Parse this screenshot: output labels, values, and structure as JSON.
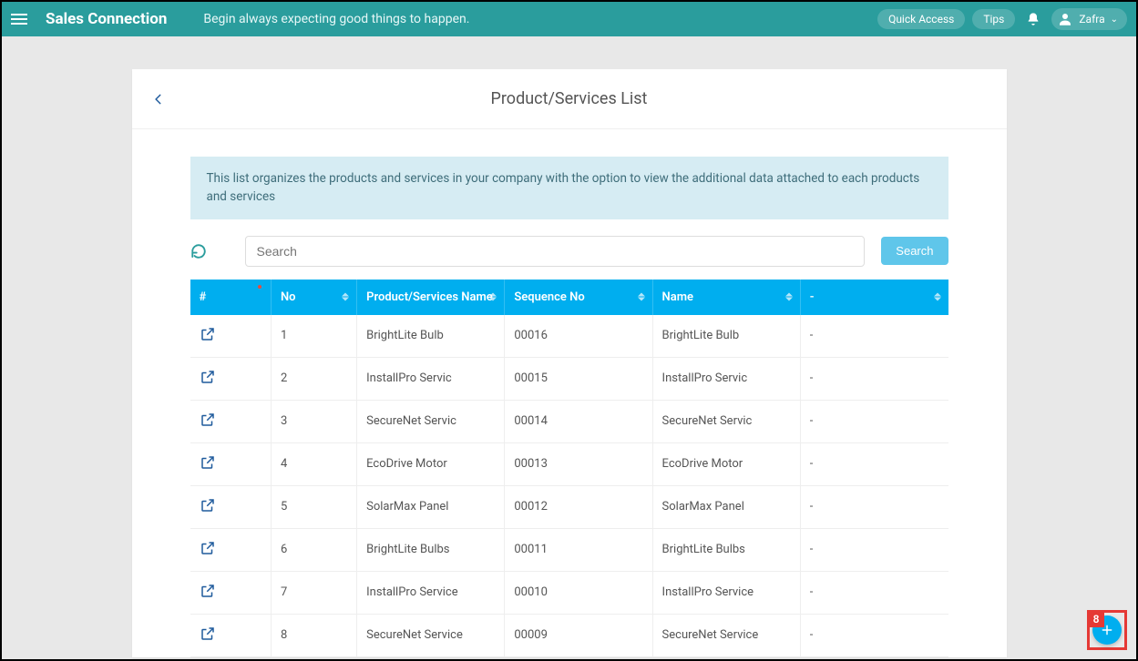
{
  "topbar": {
    "brand": "Sales Connection",
    "tagline": "Begin always expecting good things to happen.",
    "quick_access": "Quick Access",
    "tips": "Tips",
    "username": "Zafra"
  },
  "page": {
    "title": "Product/Services List",
    "info_banner": "This list organizes the products and services in your company with the option to view the additional data attached to each products and services",
    "search_placeholder": "Search",
    "search_button": "Search"
  },
  "table": {
    "headers": {
      "hash": "#",
      "no": "No",
      "ps_name": "Product/Services Name",
      "seq_no": "Sequence No",
      "name": "Name",
      "dash": "-"
    },
    "rows": [
      {
        "no": "1",
        "ps": "BrightLite Bulb",
        "seq": "00016",
        "name": "BrightLite Bulb",
        "dash": "-"
      },
      {
        "no": "2",
        "ps": "InstallPro Servic",
        "seq": "00015",
        "name": "InstallPro Servic",
        "dash": "-"
      },
      {
        "no": "3",
        "ps": "SecureNet Servic",
        "seq": "00014",
        "name": "SecureNet Servic",
        "dash": "-"
      },
      {
        "no": "4",
        "ps": "EcoDrive Motor",
        "seq": "00013",
        "name": "EcoDrive Motor",
        "dash": "-"
      },
      {
        "no": "5",
        "ps": "SolarMax Panel",
        "seq": "00012",
        "name": "SolarMax Panel",
        "dash": "-"
      },
      {
        "no": "6",
        "ps": "BrightLite Bulbs",
        "seq": "00011",
        "name": "BrightLite Bulbs",
        "dash": "-"
      },
      {
        "no": "7",
        "ps": "InstallPro Service",
        "seq": "00010",
        "name": "InstallPro Service",
        "dash": "-"
      },
      {
        "no": "8",
        "ps": "SecureNet Service",
        "seq": "00009",
        "name": "SecureNet Service",
        "dash": "-"
      }
    ]
  },
  "fab": {
    "annotation": "8"
  }
}
